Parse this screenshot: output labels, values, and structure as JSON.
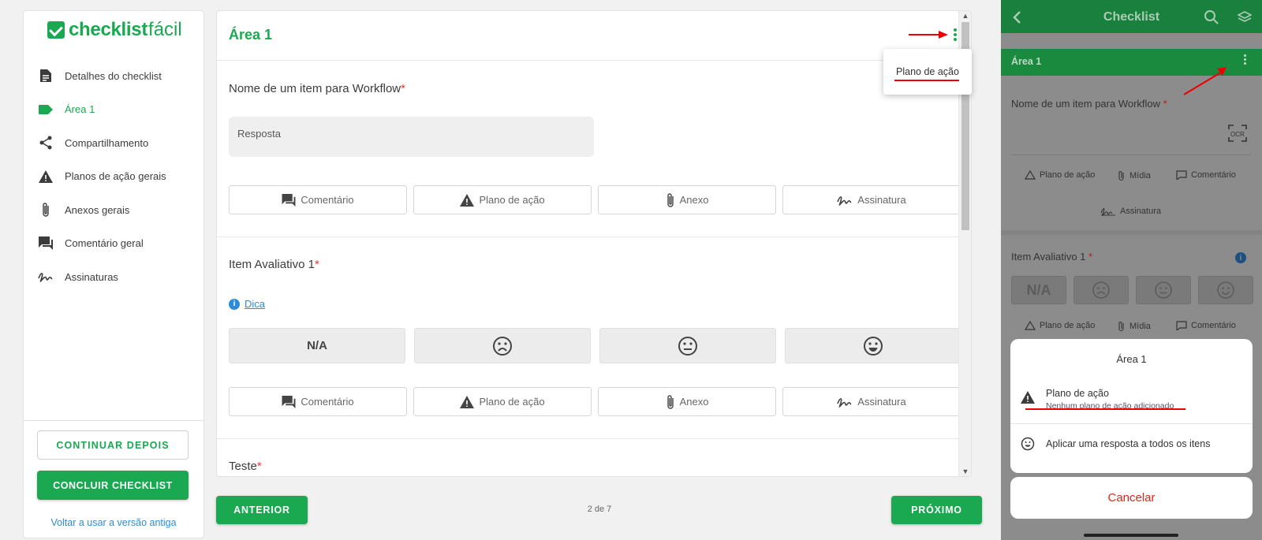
{
  "sidebar": {
    "logo": {
      "bold": "checklist",
      "light": "fácil"
    },
    "items": [
      {
        "label": "Detalhes do checklist",
        "icon": "document-icon"
      },
      {
        "label": "Área 1",
        "icon": "label-tag-icon"
      },
      {
        "label": "Compartilhamento",
        "icon": "share-icon"
      },
      {
        "label": "Planos de ação gerais",
        "icon": "warning-icon"
      },
      {
        "label": "Anexos gerais",
        "icon": "paperclip-icon"
      },
      {
        "label": "Comentário geral",
        "icon": "comment-icon"
      },
      {
        "label": "Assinaturas",
        "icon": "signature-icon"
      }
    ],
    "continue_later": "CONTINUAR DEPOIS",
    "finish": "CONCLUIR CHECKLIST",
    "old_version_link": "Voltar a usar a versão antiga"
  },
  "main": {
    "area_title": "Área 1",
    "menu_item": "Plano de ação",
    "q1": {
      "label": "Nome de um item para Workflow",
      "required": "*",
      "answer_placeholder": "Resposta"
    },
    "actions": [
      "Comentário",
      "Plano de ação",
      "Anexo",
      "Assinatura"
    ],
    "q2": {
      "label": "Item Avaliativo 1",
      "required": "*",
      "hint": "Dica",
      "options": [
        "N/A",
        "☹",
        "😐",
        "😄"
      ]
    },
    "q3": {
      "label": "Teste",
      "required": "*"
    }
  },
  "footer": {
    "prev": "ANTERIOR",
    "pager": "2 de 7",
    "next": "PRÓXIMO"
  },
  "phone": {
    "title": "Checklist",
    "area": "Área 1",
    "q1_label": "Nome de um item para Workflow",
    "q1_actions": [
      "Plano de ação",
      "Mídia",
      "Comentário"
    ],
    "q1_signature": "Assinatura",
    "q2_label": "Item Avaliativo 1",
    "q2_na": "N/A",
    "q2_actions": [
      "Plano de ação",
      "Mídia",
      "Comentário"
    ],
    "sheet": {
      "title": "Área 1",
      "action_plan_title": "Plano de ação",
      "action_plan_sub": "Nenhum plano de ação adicionado",
      "apply_all": "Aplicar uma resposta a todos os itens"
    },
    "cancel": "Cancelar"
  },
  "colors": {
    "brand": "#1aa851",
    "link": "#2e8bd6",
    "required": "#e53935",
    "annotation": "#e00000",
    "cancel": "#e5231b"
  }
}
